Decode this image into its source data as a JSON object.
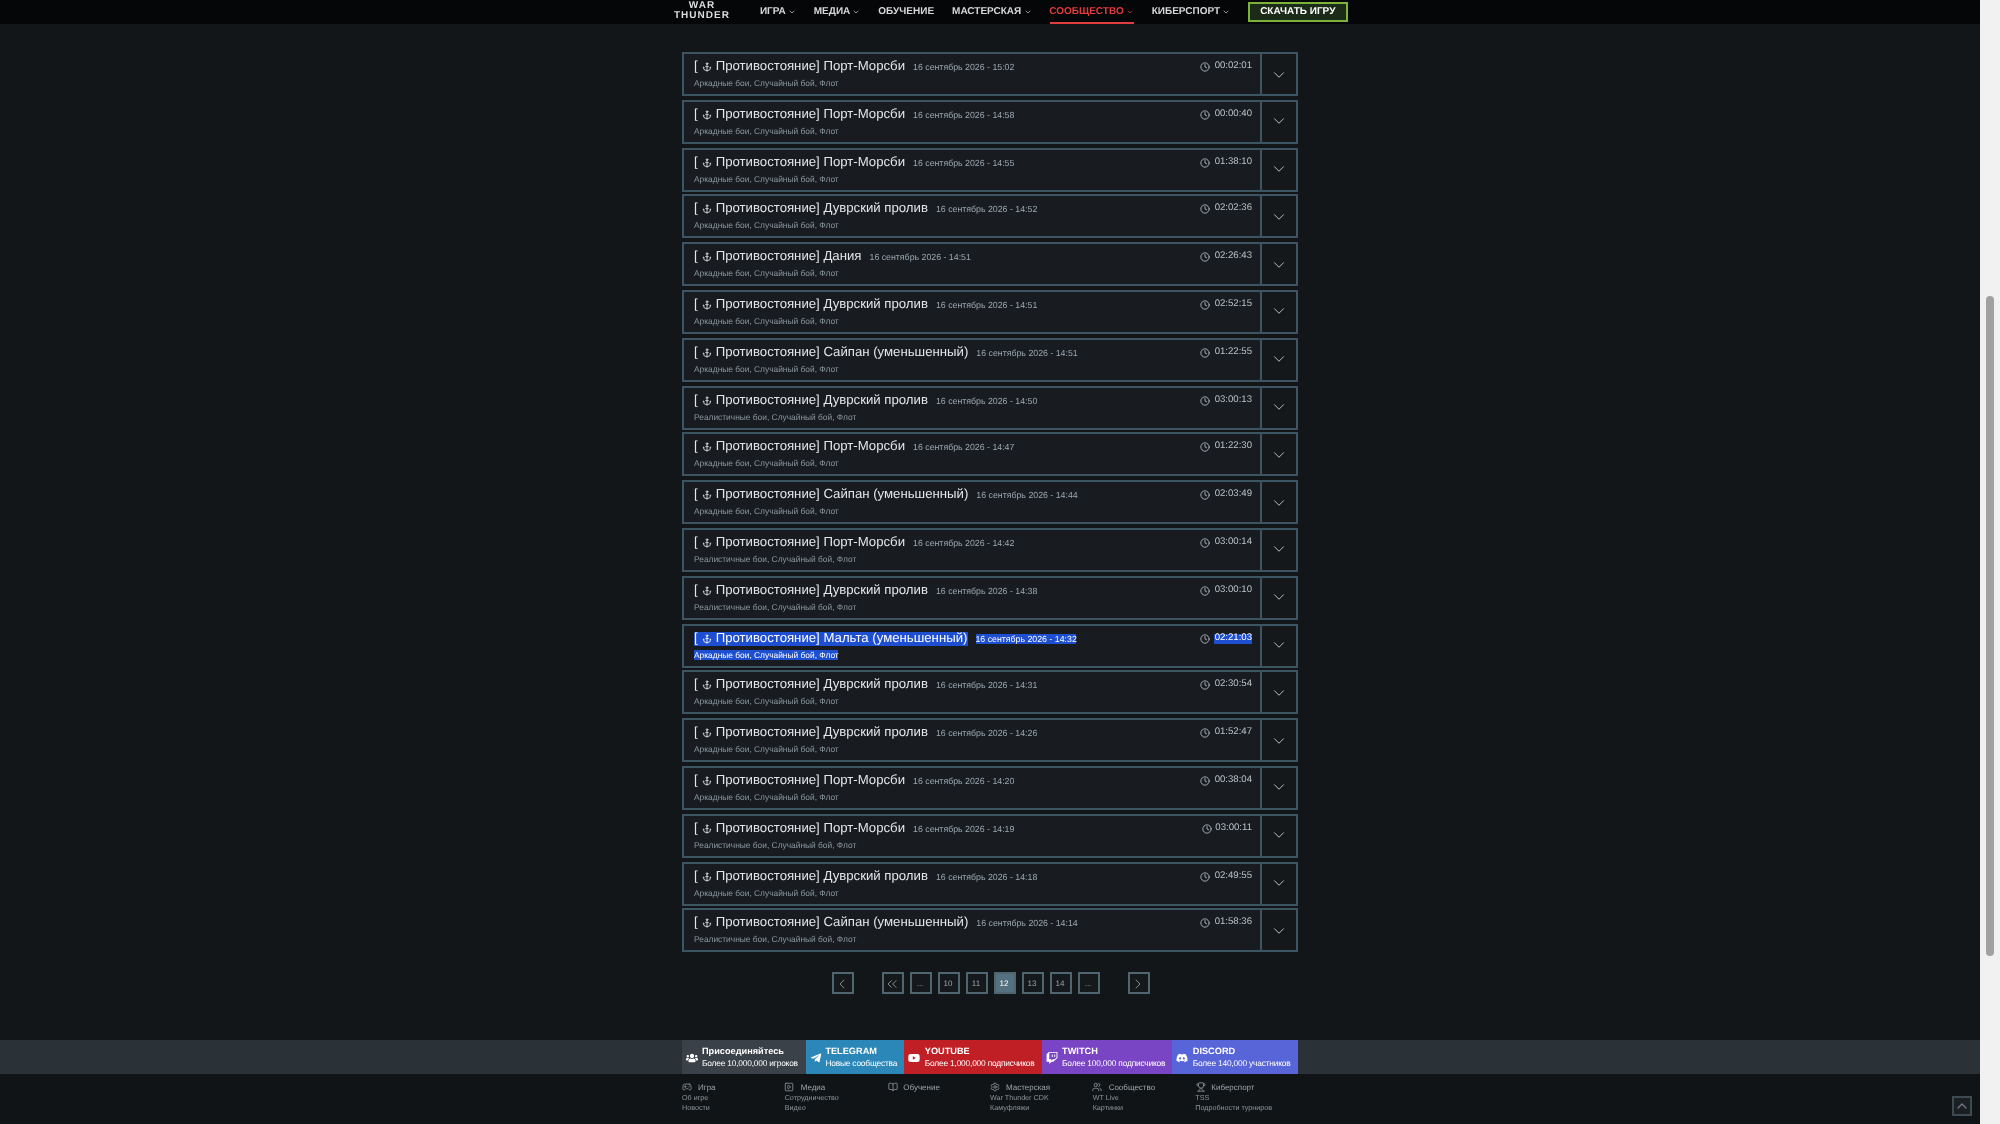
{
  "header": {
    "logo_top": "WAR",
    "logo_bottom": "THUNDER",
    "nav": [
      {
        "label": "ИГРА",
        "dropdown": true,
        "selected": false
      },
      {
        "label": "МЕДИА",
        "dropdown": true,
        "selected": false
      },
      {
        "label": "ОБУЧЕНИЕ",
        "dropdown": false,
        "selected": false
      },
      {
        "label": "МАСТЕРСКАЯ",
        "dropdown": true,
        "selected": false
      },
      {
        "label": "СООБЩЕСТВО",
        "dropdown": true,
        "selected": true
      },
      {
        "label": "КИБЕРСПОРТ",
        "dropdown": true,
        "selected": false
      }
    ],
    "download_button": "СКАЧАТЬ ИГРУ"
  },
  "battles": [
    {
      "prefix": "[",
      "title": "Противостояние] Порт-Морсби",
      "date": "16 сентябрь 2026 - 15:02",
      "modes": "Аркадные бои, Случайный бой, Флот",
      "duration": "00:02:01",
      "highlighted": false
    },
    {
      "prefix": "[",
      "title": "Противостояние] Порт-Морсби",
      "date": "16 сентябрь 2026 - 14:58",
      "modes": "Аркадные бои, Случайный бой, Флот",
      "duration": "00:00:40",
      "highlighted": false
    },
    {
      "prefix": "[",
      "title": "Противостояние] Порт-Морсби",
      "date": "16 сентябрь 2026 - 14:55",
      "modes": "Аркадные бои, Случайный бой, Флот",
      "duration": "01:38:10",
      "highlighted": false
    },
    {
      "prefix": "[",
      "title": "Противостояние] Дуврский пролив",
      "date": "16 сентябрь 2026 - 14:52",
      "modes": "Аркадные бои, Случайный бой, Флот",
      "duration": "02:02:36",
      "highlighted": false
    },
    {
      "prefix": "[",
      "title": "Противостояние] Дания",
      "date": "16 сентябрь 2026 - 14:51",
      "modes": "Аркадные бои, Случайный бой, Флот",
      "duration": "02:26:43",
      "highlighted": false
    },
    {
      "prefix": "[",
      "title": "Противостояние] Дуврский пролив",
      "date": "16 сентябрь 2026 - 14:51",
      "modes": "Аркадные бои, Случайный бой, Флот",
      "duration": "02:52:15",
      "highlighted": false
    },
    {
      "prefix": "[",
      "title": "Противостояние] Сайпан (уменьшенный)",
      "date": "16 сентябрь 2026 - 14:51",
      "modes": "Аркадные бои, Случайный бой, Флот",
      "duration": "01:22:55",
      "highlighted": false
    },
    {
      "prefix": "[",
      "title": "Противостояние] Дуврский пролив",
      "date": "16 сентябрь 2026 - 14:50",
      "modes": "Реалистичные бои, Случайный бой, Флот",
      "duration": "03:00:13",
      "highlighted": false
    },
    {
      "prefix": "[",
      "title": "Противостояние] Порт-Морсби",
      "date": "16 сентябрь 2026 - 14:47",
      "modes": "Аркадные бои, Случайный бой, Флот",
      "duration": "01:22:30",
      "highlighted": false
    },
    {
      "prefix": "[",
      "title": "Противостояние] Сайпан (уменьшенный)",
      "date": "16 сентябрь 2026 - 14:44",
      "modes": "Аркадные бои, Случайный бой, Флот",
      "duration": "02:03:49",
      "highlighted": false
    },
    {
      "prefix": "[",
      "title": "Противостояние] Порт-Морсби",
      "date": "16 сентябрь 2026 - 14:42",
      "modes": "Реалистичные бои, Случайный бой, Флот",
      "duration": "03:00:14",
      "highlighted": false
    },
    {
      "prefix": "[",
      "title": "Противостояние] Дуврский пролив",
      "date": "16 сентябрь 2026 - 14:38",
      "modes": "Реалистичные бои, Случайный бой, Флот",
      "duration": "03:00:10",
      "highlighted": false
    },
    {
      "prefix": "[",
      "title": "Противостояние] Мальта (уменьшенный)",
      "date": "16 сентябрь 2026 - 14:32",
      "modes": "Аркадные бои, Случайный бой, Флот",
      "duration": "02:21:03",
      "highlighted": true
    },
    {
      "prefix": "[",
      "title": "Противостояние] Дуврский пролив",
      "date": "16 сентябрь 2026 - 14:31",
      "modes": "Аркадные бои, Случайный бой, Флот",
      "duration": "02:30:54",
      "highlighted": false
    },
    {
      "prefix": "[",
      "title": "Противостояние] Дуврский пролив",
      "date": "16 сентябрь 2026 - 14:26",
      "modes": "Аркадные бои, Случайный бой, Флот",
      "duration": "01:52:47",
      "highlighted": false
    },
    {
      "prefix": "[",
      "title": "Противостояние] Порт-Морсби",
      "date": "16 сентябрь 2026 - 14:20",
      "modes": "Аркадные бои, Случайный бой, Флот",
      "duration": "00:38:04",
      "highlighted": false
    },
    {
      "prefix": "[",
      "title": "Противостояние] Порт-Морсби",
      "date": "16 сентябрь 2026 - 14:19",
      "modes": "Реалистичные бои, Случайный бой, Флот",
      "duration": "03:00:11",
      "highlighted": false
    },
    {
      "prefix": "[",
      "title": "Противостояние] Дуврский пролив",
      "date": "16 сентябрь 2026 - 14:18",
      "modes": "Аркадные бои, Случайный бой, Флот",
      "duration": "02:49:55",
      "highlighted": false
    },
    {
      "prefix": "[",
      "title": "Противостояние] Сайпан (уменьшенный)",
      "date": "16 сентябрь 2026 - 14:14",
      "modes": "Реалистичные бои, Случайный бой, Флот",
      "duration": "01:58:36",
      "highlighted": false
    }
  ],
  "pagination": [
    {
      "kind": "prev"
    },
    {
      "kind": "first"
    },
    {
      "kind": "page",
      "label": "...",
      "selected": false
    },
    {
      "kind": "page",
      "label": "10",
      "selected": false
    },
    {
      "kind": "page",
      "label": "11",
      "selected": false
    },
    {
      "kind": "page",
      "label": "12",
      "selected": true
    },
    {
      "kind": "page",
      "label": "13",
      "selected": false
    },
    {
      "kind": "page",
      "label": "14",
      "selected": false
    },
    {
      "kind": "page",
      "label": "...",
      "selected": false
    },
    {
      "kind": "next"
    }
  ],
  "social": [
    {
      "kind": "community",
      "title": "Присоединяйтесь",
      "subtitle": "Более 10,000,000 игроков",
      "color": "#3a4148"
    },
    {
      "kind": "telegram",
      "title": "TELEGRAM",
      "subtitle": "Новые сообщества",
      "color": "#2a87b8"
    },
    {
      "kind": "youtube",
      "title": "YOUTUBE",
      "subtitle": "Более 1,000,000 подписчиков",
      "color": "#c01f25"
    },
    {
      "kind": "twitch",
      "title": "TWITCH",
      "subtitle": "Более 100,000 подписчиков",
      "color": "#7a45c4"
    },
    {
      "kind": "discord",
      "title": "DISCORD",
      "subtitle": "Более 140,000 участников",
      "color": "#5865d8"
    }
  ],
  "footer_columns": [
    {
      "kind": "game",
      "title": "Игра",
      "links": [
        "Об игре",
        "Новости"
      ]
    },
    {
      "kind": "media",
      "title": "Медиа",
      "links": [
        "Сотрудничество",
        "Видео"
      ]
    },
    {
      "kind": "learn",
      "title": "Обучение"
    },
    {
      "kind": "workshop",
      "title": "Мастерская",
      "links": [
        "War Thunder CDK",
        "Камуфляжи"
      ]
    },
    {
      "kind": "community",
      "title": "Сообщество",
      "links": [
        "WT Live",
        "Картинки"
      ]
    },
    {
      "kind": "esports",
      "title": "Киберспорт",
      "links": [
        "TSS",
        "Подробности турниров"
      ]
    }
  ]
}
